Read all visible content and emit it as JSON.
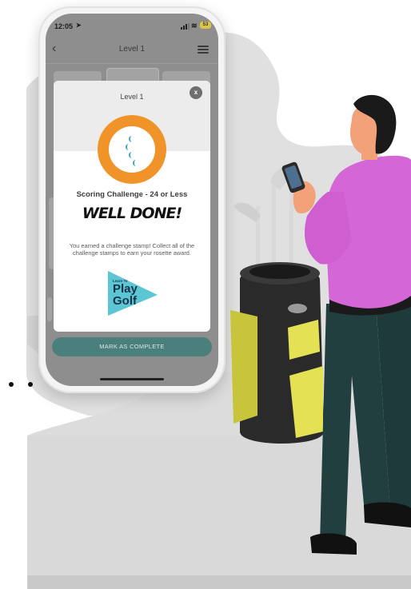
{
  "status_bar": {
    "time": "12:05",
    "location_icon": "location-arrow-icon",
    "signal_icon": "cellular-signal-icon",
    "wifi_icon": "wifi-icon",
    "battery_level": "53"
  },
  "app_bar": {
    "back_icon": "chevron-left-icon",
    "title": "Level 1",
    "menu_icon": "hamburger-menu-icon"
  },
  "modal": {
    "title": "Level 1",
    "close_label": "x",
    "badge_icon": "golf-ball-medal-icon",
    "challenge_title": "Scoring Challenge - 24 or Less",
    "headline": "WELL DONE!",
    "description": "You earned a challenge stamp! Collect all of the challenge stamps to earn your rosette award.",
    "logo": {
      "line1": "Learn To",
      "line2": "Play",
      "line3": "Golf"
    }
  },
  "footer": {
    "button_label": "MARK AS COMPLETE"
  },
  "colors": {
    "medal_orange": "#f0942a",
    "button_teal": "#4b7f7c",
    "logo_teal": "#5cc6d5",
    "shirt_pink": "#d466d6",
    "bag_yellow": "#e4e154"
  },
  "illustration": {
    "subject": "golfer-with-golf-bag-illustration"
  }
}
